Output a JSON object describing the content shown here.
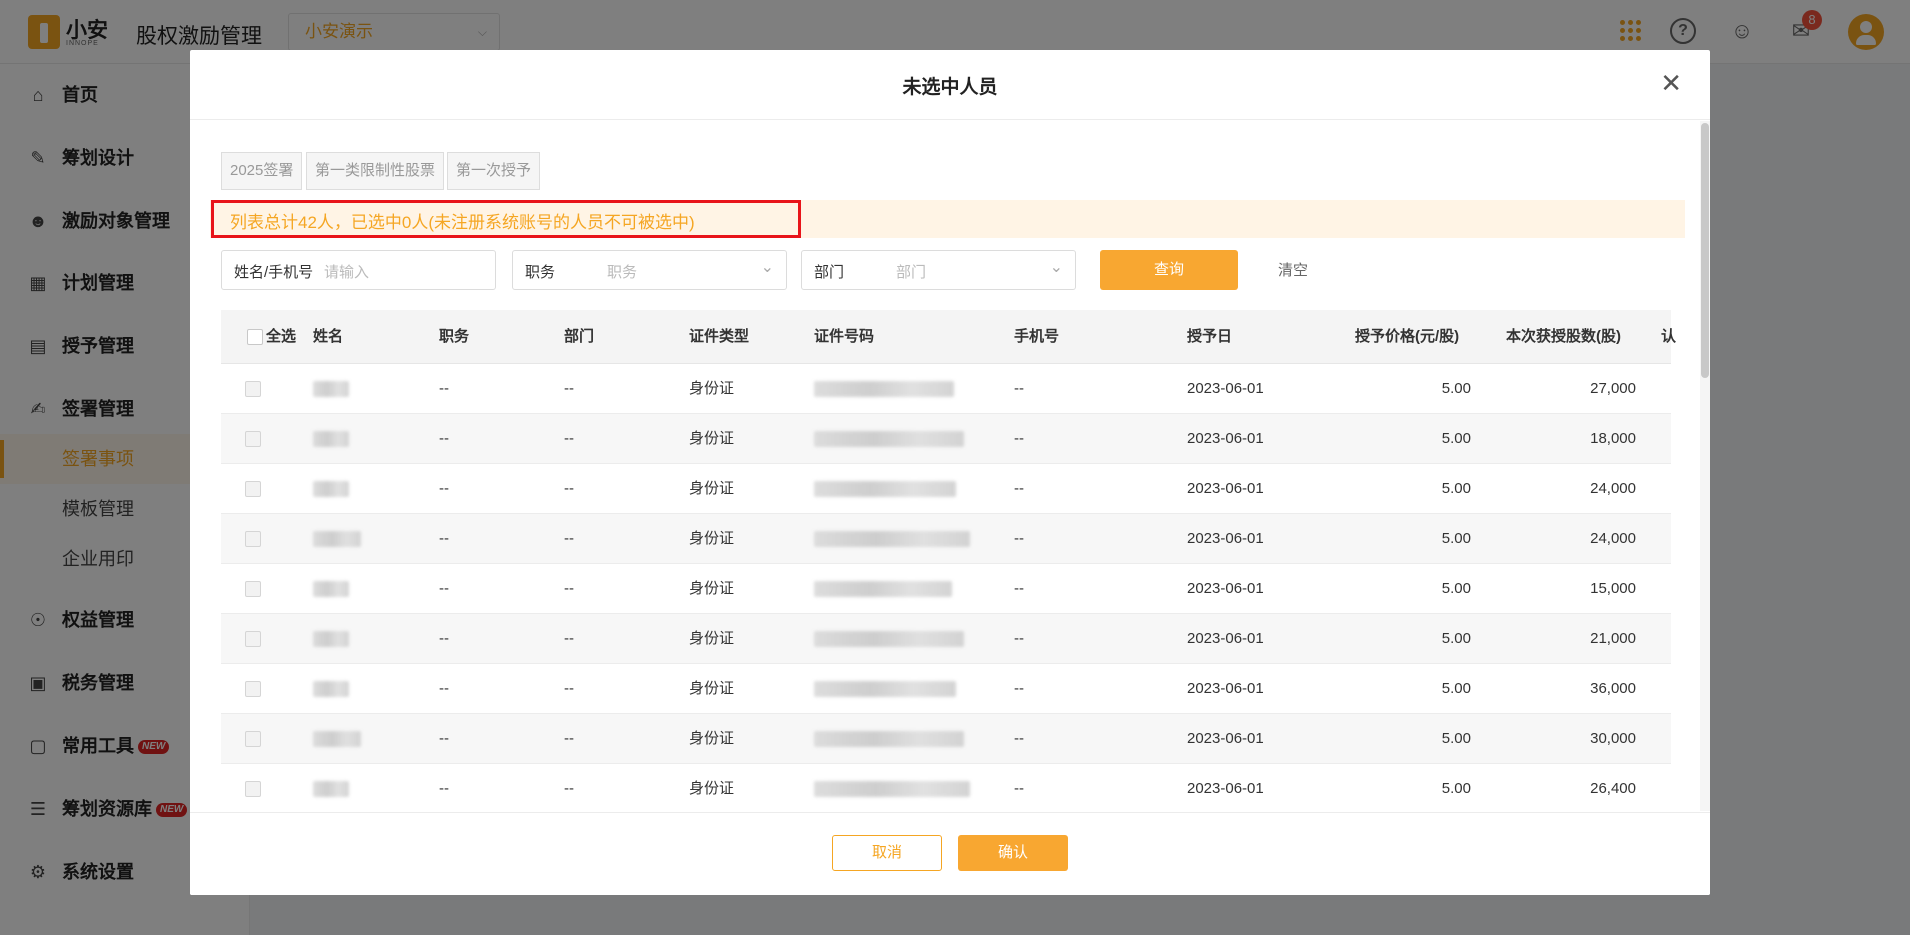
{
  "header": {
    "brand_name": "小安",
    "brand_sub": "INNOPE",
    "app_title": "股权激励管理",
    "org_select_value": "小安演示",
    "message_badge": "8"
  },
  "sidebar": {
    "items": [
      {
        "label": "首页",
        "icon": "home-icon"
      },
      {
        "label": "筹划设计",
        "icon": "edit-icon"
      },
      {
        "label": "激励对象管理",
        "icon": "users-icon"
      },
      {
        "label": "计划管理",
        "icon": "apps-icon"
      },
      {
        "label": "授予管理",
        "icon": "grant-icon"
      },
      {
        "label": "签署管理",
        "icon": "sign-icon"
      },
      {
        "label": "签署事项",
        "sub": true,
        "active": true
      },
      {
        "label": "模板管理",
        "sub": true
      },
      {
        "label": "企业用印",
        "sub": true
      },
      {
        "label": "权益管理",
        "icon": "equity-icon"
      },
      {
        "label": "税务管理",
        "icon": "tax-icon"
      },
      {
        "label": "常用工具",
        "icon": "toolbox-icon",
        "tag": "NEW"
      },
      {
        "label": "筹划资源库",
        "icon": "layers-icon",
        "tag": "NEW"
      },
      {
        "label": "系统设置",
        "icon": "settings-icon"
      }
    ]
  },
  "modal": {
    "title": "未选中人员",
    "tags": [
      "2025签署",
      "第一类限制性股票",
      "第一次授予"
    ],
    "notice": "列表总计42人，已选中0人(未注册系统账号的人员不可被选中)",
    "filters": {
      "name_label": "姓名/手机号",
      "name_placeholder": "请输入",
      "position_label": "职务",
      "position_placeholder": "职务",
      "dept_label": "部门",
      "dept_placeholder": "部门"
    },
    "query_label": "查询",
    "clear_label": "清空",
    "table": {
      "select_all": "全选",
      "columns": [
        "姓名",
        "职务",
        "部门",
        "证件类型",
        "证件号码",
        "手机号",
        "授予日",
        "授予价格(元/股)",
        "本次获授股数(股)",
        "认"
      ],
      "rows": [
        {
          "position": "--",
          "dept": "--",
          "id_type": "身份证",
          "phone": "--",
          "grant_date": "2023-06-01",
          "price": "5.00",
          "shares": "27,000"
        },
        {
          "position": "--",
          "dept": "--",
          "id_type": "身份证",
          "phone": "--",
          "grant_date": "2023-06-01",
          "price": "5.00",
          "shares": "18,000"
        },
        {
          "position": "--",
          "dept": "--",
          "id_type": "身份证",
          "phone": "--",
          "grant_date": "2023-06-01",
          "price": "5.00",
          "shares": "24,000"
        },
        {
          "position": "--",
          "dept": "--",
          "id_type": "身份证",
          "phone": "--",
          "grant_date": "2023-06-01",
          "price": "5.00",
          "shares": "24,000"
        },
        {
          "position": "--",
          "dept": "--",
          "id_type": "身份证",
          "phone": "--",
          "grant_date": "2023-06-01",
          "price": "5.00",
          "shares": "15,000"
        },
        {
          "position": "--",
          "dept": "--",
          "id_type": "身份证",
          "phone": "--",
          "grant_date": "2023-06-01",
          "price": "5.00",
          "shares": "21,000"
        },
        {
          "position": "--",
          "dept": "--",
          "id_type": "身份证",
          "phone": "--",
          "grant_date": "2023-06-01",
          "price": "5.00",
          "shares": "36,000"
        },
        {
          "position": "--",
          "dept": "--",
          "id_type": "身份证",
          "phone": "--",
          "grant_date": "2023-06-01",
          "price": "5.00",
          "shares": "30,000"
        },
        {
          "position": "--",
          "dept": "--",
          "id_type": "身份证",
          "phone": "--",
          "grant_date": "2023-06-01",
          "price": "5.00",
          "shares": "26,400"
        }
      ]
    },
    "cancel_label": "取消",
    "confirm_label": "确认"
  },
  "colors": {
    "accent": "#f8a731",
    "highlight_border": "#e8141a",
    "notice_bg": "#fff4e5"
  }
}
